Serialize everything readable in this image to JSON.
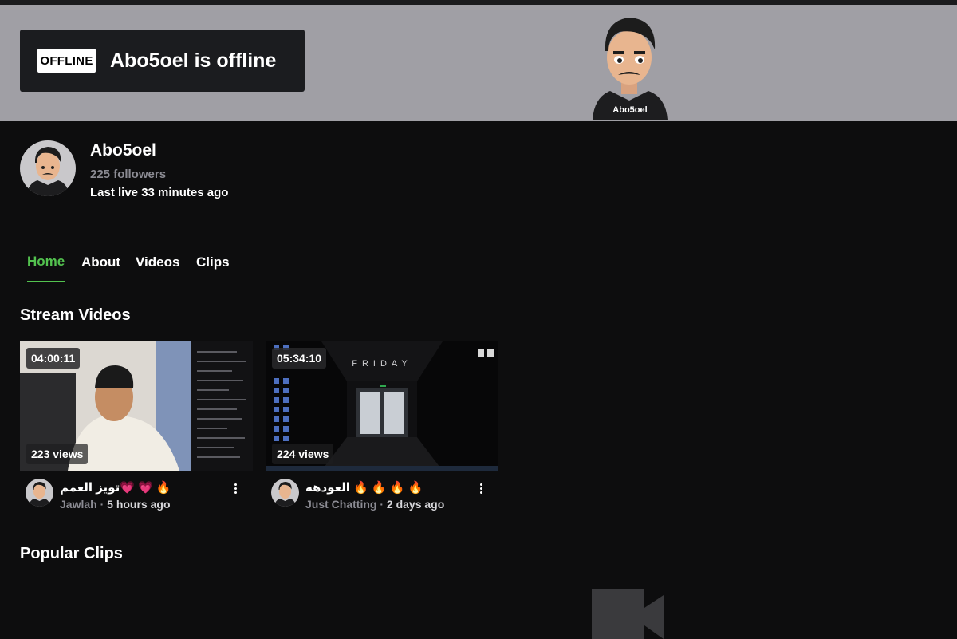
{
  "banner": {
    "offline_badge": "OFFLINE",
    "offline_text": "Abo5oel is offline"
  },
  "profile": {
    "name": "Abo5oel",
    "followers": "225 followers",
    "last_live": "Last live 33 minutes ago",
    "avatar_shirt_text": "Abo5oel"
  },
  "tabs": [
    {
      "label": "Home",
      "active": true
    },
    {
      "label": "About",
      "active": false
    },
    {
      "label": "Videos",
      "active": false
    },
    {
      "label": "Clips",
      "active": false
    }
  ],
  "sections": {
    "stream_videos": "Stream Videos",
    "popular_clips": "Popular Clips"
  },
  "videos": [
    {
      "duration": "04:00:11",
      "views": "223 views",
      "title": "تويز العمم💗 💗 🔥",
      "category": "Jawlah",
      "separator": " · ",
      "ago": "5 hours ago"
    },
    {
      "duration": "05:34:10",
      "views": "224 views",
      "title": "العودهه 🔥 🔥 🔥 🔥",
      "category": "Just Chatting",
      "separator": " · ",
      "ago": "2 days ago",
      "thumb_text": "FRIDAY"
    }
  ],
  "colors": {
    "accent": "#53c24f",
    "background": "#0d0d0e",
    "banner": "#a09fa5",
    "muted_text": "#8b8b93"
  },
  "icons": {
    "menu": "vertical-ellipsis-icon",
    "empty_clips": "video-camera-icon"
  }
}
